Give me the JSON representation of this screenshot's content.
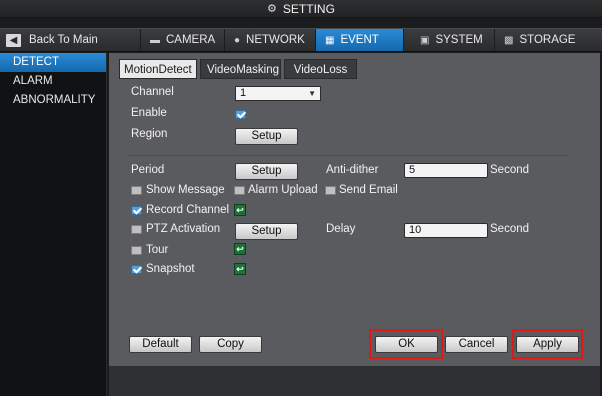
{
  "window": {
    "title": "SETTING",
    "icon": "gear-icon"
  },
  "nav": {
    "back_label": "Back To Main",
    "tabs": [
      {
        "label": "CAMERA",
        "icon": "camera-icon",
        "active": false
      },
      {
        "label": "NETWORK",
        "icon": "globe-icon",
        "active": false
      },
      {
        "label": "EVENT",
        "icon": "event-icon",
        "active": true
      },
      {
        "label": "SYSTEM",
        "icon": "system-icon",
        "active": false
      },
      {
        "label": "STORAGE",
        "icon": "storage-icon",
        "active": false
      }
    ]
  },
  "sidebar": {
    "items": [
      {
        "label": "DETECT",
        "active": true
      },
      {
        "label": "ALARM",
        "active": false
      },
      {
        "label": "ABNORMALITY",
        "active": false
      }
    ]
  },
  "subtabs": [
    {
      "label": "MotionDetect",
      "active": true
    },
    {
      "label": "VideoMasking",
      "active": false
    },
    {
      "label": "VideoLoss",
      "active": false
    }
  ],
  "form": {
    "channel_label": "Channel",
    "channel_value": "1",
    "enable_label": "Enable",
    "enable_checked": true,
    "region_label": "Region",
    "region_button": "Setup",
    "period_label": "Period",
    "period_button": "Setup",
    "antidither_label": "Anti-dither",
    "antidither_value": "5",
    "antidither_unit": "Second",
    "show_message_label": "Show Message",
    "show_message_checked": false,
    "alarm_upload_label": "Alarm Upload",
    "alarm_upload_checked": false,
    "send_email_label": "Send Email",
    "send_email_checked": false,
    "record_channel_label": "Record Channel",
    "record_channel_checked": true,
    "ptz_label": "PTZ Activation",
    "ptz_checked": false,
    "ptz_button": "Setup",
    "delay_label": "Delay",
    "delay_value": "10",
    "delay_unit": "Second",
    "tour_label": "Tour",
    "tour_checked": false,
    "snapshot_label": "Snapshot",
    "snapshot_checked": true
  },
  "footer": {
    "default_label": "Default",
    "copy_label": "Copy",
    "ok_label": "OK",
    "cancel_label": "Cancel",
    "apply_label": "Apply"
  },
  "colors": {
    "accent": "#1f7cc4",
    "highlight": "#e01818"
  }
}
